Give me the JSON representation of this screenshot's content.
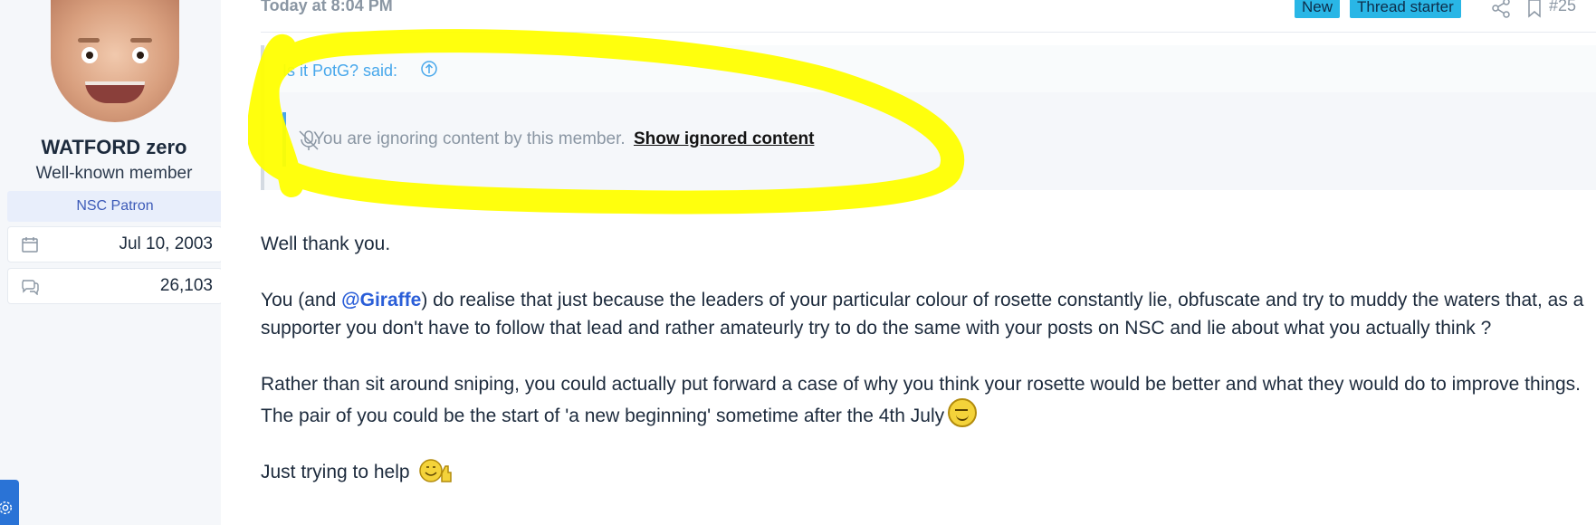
{
  "user": {
    "name": "WATFORD zero",
    "title": "Well-known member",
    "banner": "NSC Patron",
    "joined": "Jul 10, 2003",
    "messages": "26,103"
  },
  "post": {
    "date": "Today at 8:04 PM",
    "badges": [
      "New",
      "Thread starter"
    ],
    "number": "#25",
    "quote": {
      "attribution": "Is it PotG? said:",
      "ignored_text": "You are ignoring content by this member.",
      "show_link": "Show ignored content"
    },
    "body": {
      "p1": "Well thank you.",
      "p2_pre": "You (and ",
      "p2_mention": "@Giraffe",
      "p2_post": ") do realise that just because the leaders of your particular colour of rosette constantly lie, obfuscate and try to muddy the waters that, as a supporter you don't have to follow that lead and rather amateurly try to do the same with your posts on NSC and lie about what you actually think ?",
      "p3": "Rather than sit around sniping, you could actually put forward a case of why you think your rosette would be better and what they would do to improve things. The pair of you could be the start of 'a new beginning' sometime after the 4th July",
      "p4": "Just trying to help"
    }
  },
  "colors": {
    "highlight": "#ffff00",
    "badge": "#29b6e6",
    "link": "#47a7eb",
    "mention": "#2a5ed8"
  },
  "icons": [
    "calendar-icon",
    "messages-icon",
    "share-icon",
    "bookmark-icon",
    "arrow-up-icon",
    "mic-off-icon",
    "gear-icon",
    "smile-emoji-icon",
    "thumbs-up-emoji-icon"
  ]
}
